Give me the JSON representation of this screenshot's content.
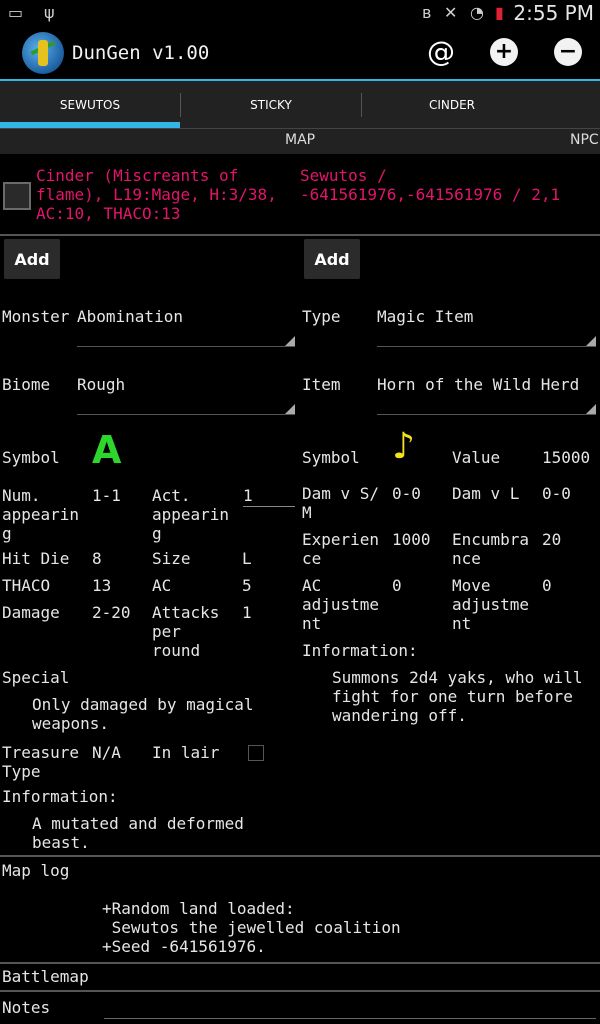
{
  "status_bar": {
    "time": "2:55 PM"
  },
  "app": {
    "title": "DunGen v1.00"
  },
  "tabs": [
    {
      "label": "SEWUTOS"
    },
    {
      "label": "STICKY"
    },
    {
      "label": "CINDER"
    }
  ],
  "subtabs": {
    "map": "MAP",
    "npc": "NPC"
  },
  "character": {
    "line1": "Cinder (Miscreants of",
    "line2": "flame), L19:Mage, H:3/38,",
    "line3": "AC:10, THACO:13"
  },
  "location": {
    "line1": "Sewutos /",
    "line2": "-641561976,-641561976 / 2,1"
  },
  "add_left": "Add",
  "add_right": "Add",
  "monster": {
    "label": "Monster",
    "value": "Abomination",
    "biome_label": "Biome",
    "biome_value": "Rough",
    "symbol_label": "Symbol",
    "symbol": "A",
    "num_appearing_label": [
      "Num.",
      "appearin",
      "g"
    ],
    "num_appearing": "1-1",
    "act_appearing_label": [
      "Act.",
      "appearin",
      "g"
    ],
    "act_appearing": "1",
    "hit_die_label": "Hit Die",
    "hit_die": "8",
    "size_label": "Size",
    "size": "L",
    "thaco_label": "THACO",
    "thaco": "13",
    "ac_label": "AC",
    "ac": "5",
    "damage_label": "Damage",
    "damage": "2-20",
    "attacks_label": [
      "Attacks",
      "per",
      "round"
    ],
    "attacks": "1",
    "special_label": "Special",
    "special": [
      "Only damaged by magical",
      "weapons."
    ],
    "treasure_label": [
      "Treasure",
      "Type"
    ],
    "treasure": "N/A",
    "lair_label": "In lair",
    "info_label": "Information:",
    "info": [
      "A mutated and deformed",
      "beast."
    ],
    "symbol_color": "#2dd62d"
  },
  "item": {
    "type_label": "Type",
    "type_value": "Magic Item",
    "item_label": "Item",
    "item_value": "Horn of the Wild Herd",
    "symbol_label": "Symbol",
    "symbol": "♪",
    "symbol_color": "#f2e21a",
    "value_label": "Value",
    "value": "15000",
    "dam_sm_label": [
      "Dam v S/",
      "M"
    ],
    "dam_sm": "0-0",
    "dam_l_label": "Dam v L",
    "dam_l": "0-0",
    "exp_label": [
      "Experien",
      "ce"
    ],
    "exp": "1000",
    "enc_label": [
      "Encumbra",
      "nce"
    ],
    "enc": "20",
    "ac_adj_label": [
      "AC",
      "adjustme",
      "nt"
    ],
    "ac_adj": "0",
    "move_adj_label": [
      "Move",
      "adjustme",
      "nt"
    ],
    "move_adj": "0",
    "info_label": "Information:",
    "info": [
      "Summons 2d4 yaks, who will",
      "fight for one turn before",
      "wandering off."
    ]
  },
  "map_log": {
    "label": "Map log",
    "lines": [
      "+Random land loaded:",
      " Sewutos the jewelled coalition",
      "+Seed -641561976."
    ]
  },
  "battlemap_label": "Battlemap",
  "notes_label": "Notes"
}
